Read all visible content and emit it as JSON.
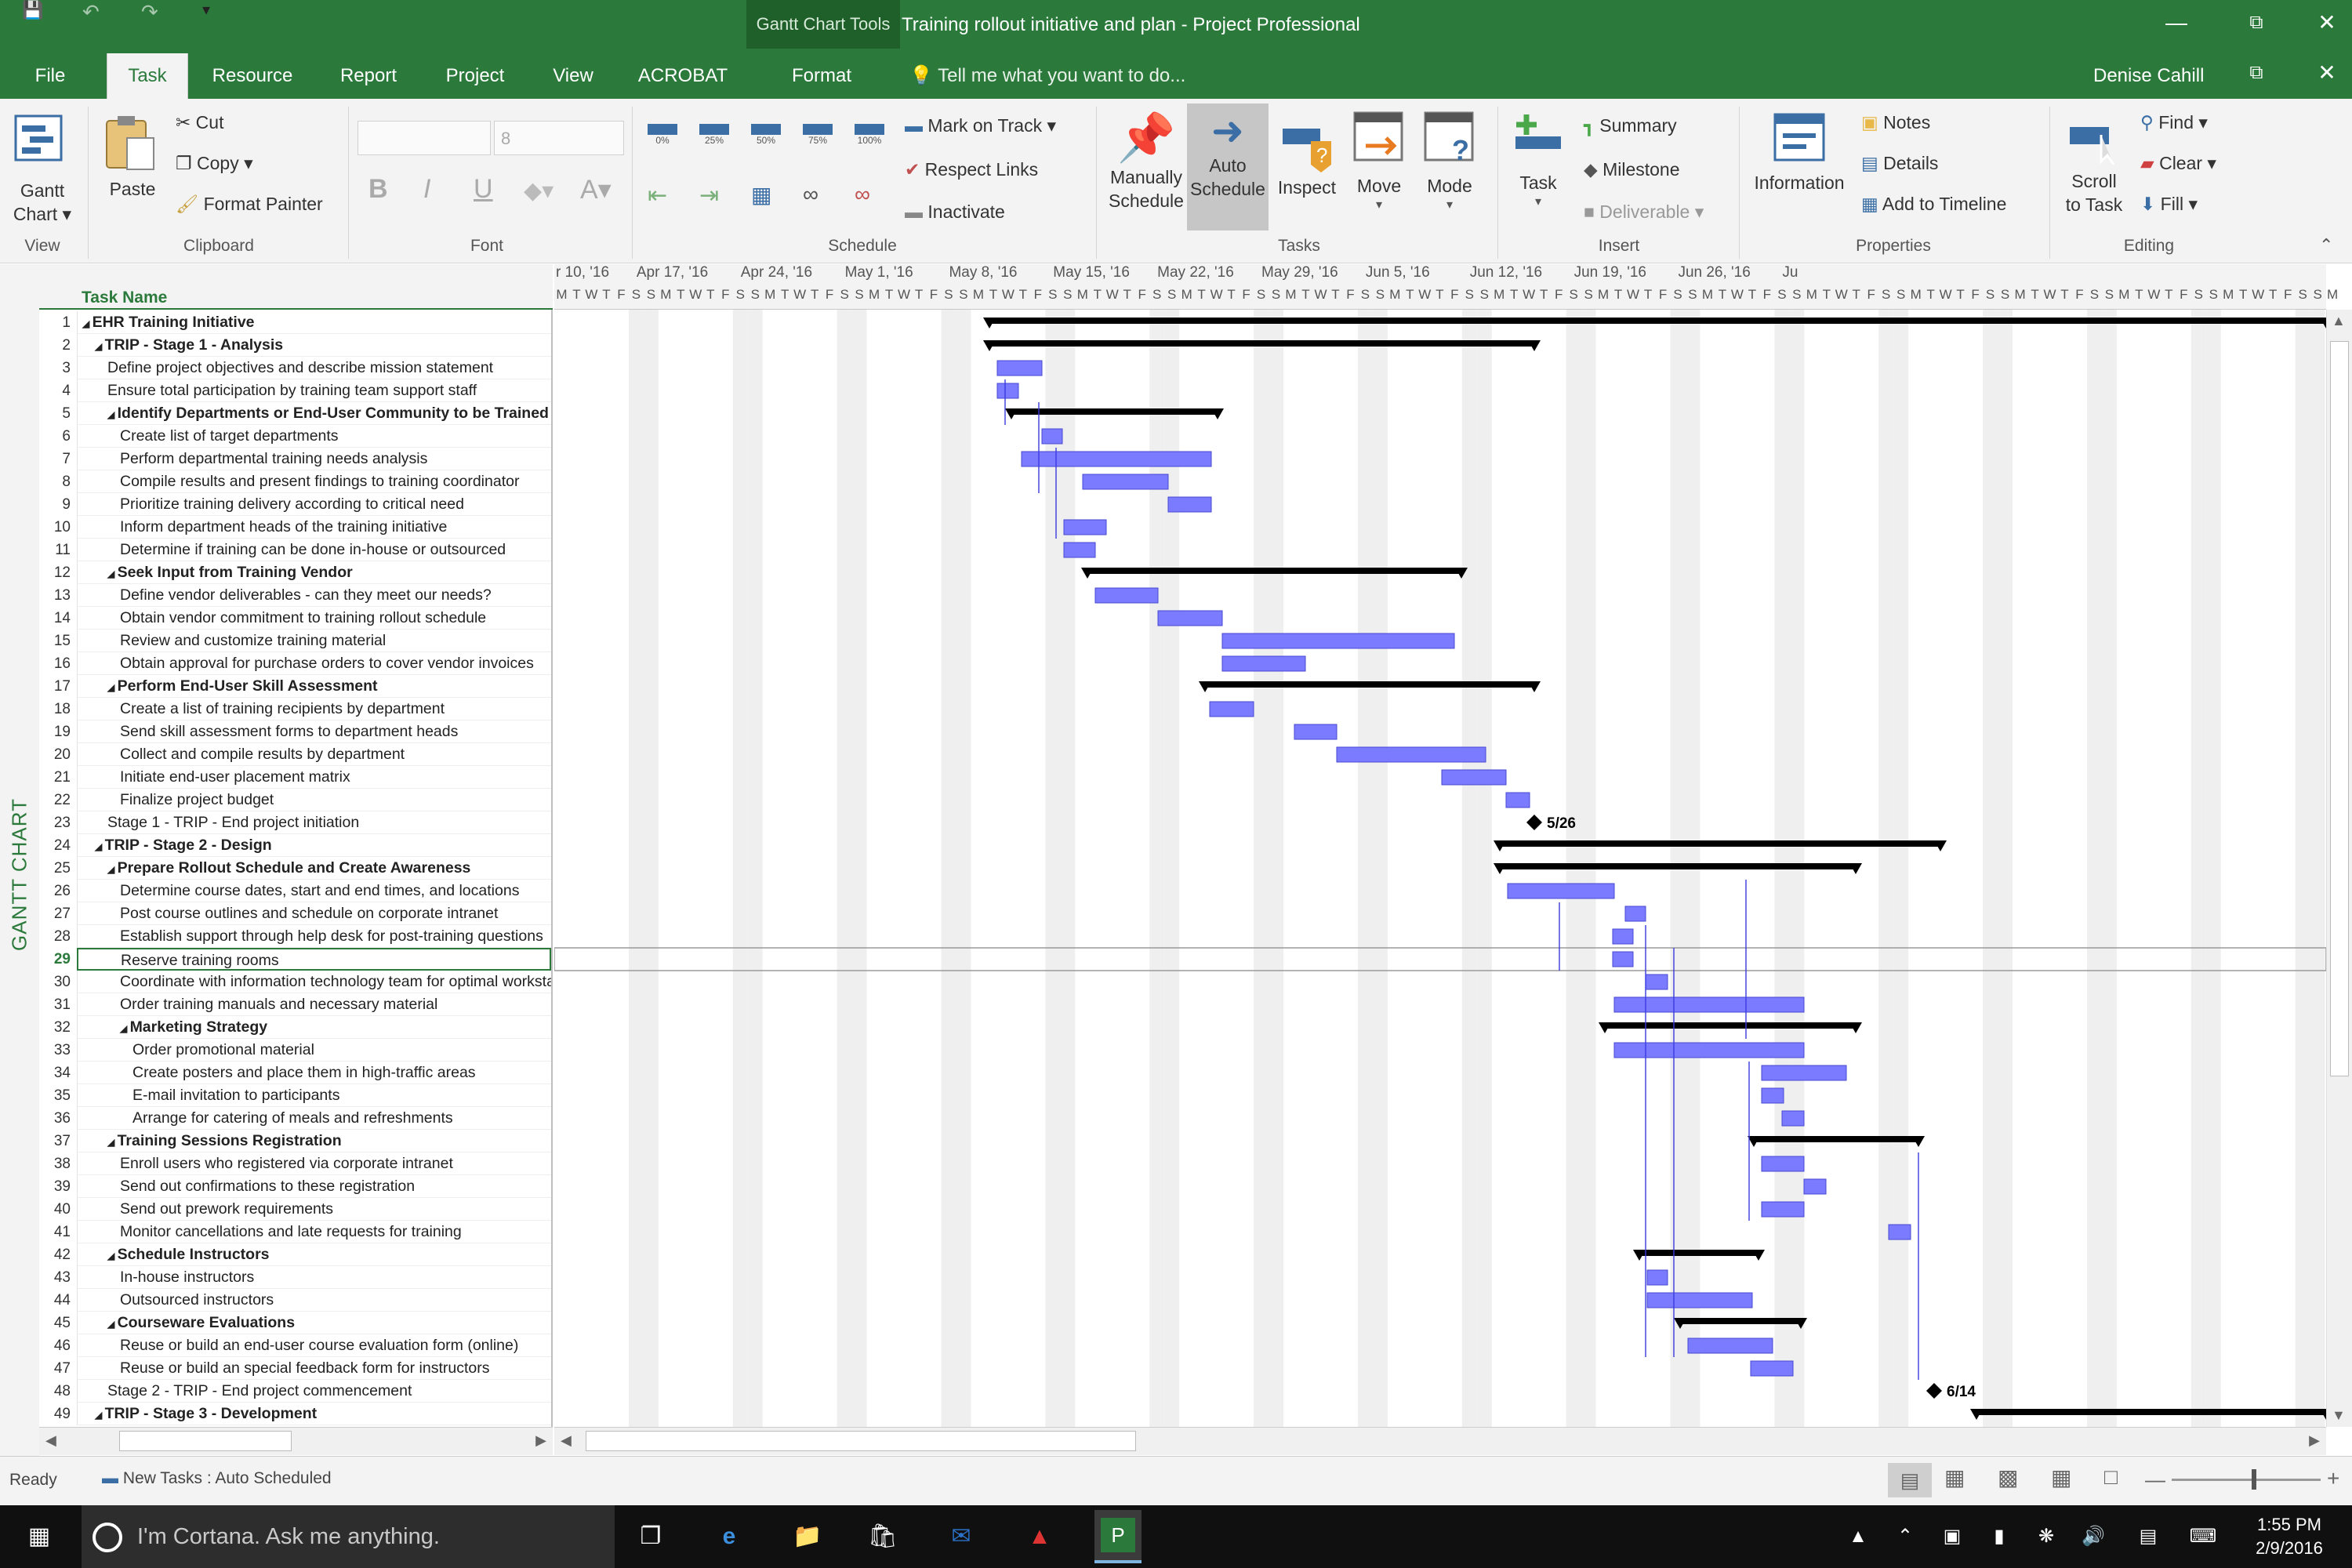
{
  "window": {
    "title": "Training rollout initiative and plan - Project Professional",
    "context_tools": "Gantt Chart Tools",
    "user": "Denise Cahill"
  },
  "tabs": [
    "File",
    "Task",
    "Resource",
    "Report",
    "Project",
    "View",
    "ACROBAT",
    "Format"
  ],
  "active_tab": "Task",
  "tellme": "Tell me what you want to do...",
  "ribbon": {
    "view": {
      "gantt_chart": "Gantt Chart",
      "group": "View",
      "gantt_l1": "Gantt",
      "gantt_l2": "Chart"
    },
    "clipboard": {
      "paste": "Paste",
      "cut": "Cut",
      "copy": "Copy",
      "format_painter": "Format Painter",
      "group": "Clipboard"
    },
    "font": {
      "size": "8",
      "group": "Font"
    },
    "schedule": {
      "pcts": [
        "0%",
        "25%",
        "50%",
        "75%",
        "100%"
      ],
      "mark_on_track": "Mark on Track",
      "respect_links": "Respect Links",
      "inactivate": "Inactivate",
      "group": "Schedule"
    },
    "tasks": {
      "manually_l1": "Manually",
      "manually_l2": "Schedule",
      "auto_l1": "Auto",
      "auto_l2": "Schedule",
      "inspect": "Inspect",
      "move": "Move",
      "mode": "Mode",
      "group": "Tasks"
    },
    "insert": {
      "task": "Task",
      "summary": "Summary",
      "milestone": "Milestone",
      "deliverable": "Deliverable",
      "group": "Insert"
    },
    "properties": {
      "information": "Information",
      "notes": "Notes",
      "details": "Details",
      "add_to_timeline": "Add to Timeline",
      "group": "Properties"
    },
    "editing": {
      "scroll_l1": "Scroll",
      "scroll_l2": "to Task",
      "find": "Find",
      "clear": "Clear",
      "fill": "Fill",
      "group": "Editing"
    }
  },
  "side_label": "GANTT CHART",
  "table": {
    "header": "Task Name"
  },
  "timescale": {
    "weeks": [
      "r 10, '16",
      "Apr 17, '16",
      "Apr 24, '16",
      "May 1, '16",
      "May 8, '16",
      "May 15, '16",
      "May 22, '16",
      "May 29, '16",
      "Jun 5, '16",
      "Jun 12, '16",
      "Jun 19, '16",
      "Jun 26, '16",
      "Ju"
    ],
    "days": [
      "M",
      "T",
      "W",
      "T",
      "F",
      "S",
      "S"
    ]
  },
  "tasks": [
    {
      "id": "1",
      "name": "EHR Training Initiative",
      "level": 0,
      "summary": true
    },
    {
      "id": "2",
      "name": "TRIP - Stage 1 - Analysis",
      "level": 1,
      "summary": true
    },
    {
      "id": "3",
      "name": "Define project objectives and describe mission statement",
      "level": 2,
      "summary": false
    },
    {
      "id": "4",
      "name": "Ensure total participation by training team support staff",
      "level": 2,
      "summary": false
    },
    {
      "id": "5",
      "name": "Identify Departments or End-User Community to be Trained",
      "level": 2,
      "summary": true
    },
    {
      "id": "6",
      "name": "Create list of target departments",
      "level": 3,
      "summary": false
    },
    {
      "id": "7",
      "name": "Perform departmental training needs analysis",
      "level": 3,
      "summary": false
    },
    {
      "id": "8",
      "name": "Compile results and present findings to training coordinator",
      "level": 3,
      "summary": false
    },
    {
      "id": "9",
      "name": "Prioritize training delivery according to critical need",
      "level": 3,
      "summary": false
    },
    {
      "id": "10",
      "name": "Inform department heads of the training initiative",
      "level": 3,
      "summary": false
    },
    {
      "id": "11",
      "name": "Determine if training can be done in-house or outsourced",
      "level": 3,
      "summary": false
    },
    {
      "id": "12",
      "name": "Seek Input from Training Vendor",
      "level": 2,
      "summary": true
    },
    {
      "id": "13",
      "name": "Define vendor deliverables - can they meet our needs?",
      "level": 3,
      "summary": false
    },
    {
      "id": "14",
      "name": "Obtain vendor commitment to training rollout schedule",
      "level": 3,
      "summary": false
    },
    {
      "id": "15",
      "name": "Review and customize training material",
      "level": 3,
      "summary": false
    },
    {
      "id": "16",
      "name": "Obtain approval for purchase orders to cover vendor invoices",
      "level": 3,
      "summary": false
    },
    {
      "id": "17",
      "name": "Perform End-User Skill Assessment",
      "level": 2,
      "summary": true
    },
    {
      "id": "18",
      "name": "Create a list of training recipients by department",
      "level": 3,
      "summary": false
    },
    {
      "id": "19",
      "name": "Send skill assessment forms to department heads",
      "level": 3,
      "summary": false
    },
    {
      "id": "20",
      "name": "Collect and compile results by department",
      "level": 3,
      "summary": false
    },
    {
      "id": "21",
      "name": "Initiate end-user placement matrix",
      "level": 3,
      "summary": false
    },
    {
      "id": "22",
      "name": "Finalize project budget",
      "level": 3,
      "summary": false
    },
    {
      "id": "23",
      "name": "Stage 1 - TRIP - End project initiation",
      "level": 2,
      "summary": false
    },
    {
      "id": "24",
      "name": "TRIP - Stage 2 - Design",
      "level": 1,
      "summary": true
    },
    {
      "id": "25",
      "name": "Prepare Rollout Schedule and Create Awareness",
      "level": 2,
      "summary": true
    },
    {
      "id": "26",
      "name": "Determine course dates, start and end times, and locations",
      "level": 3,
      "summary": false
    },
    {
      "id": "27",
      "name": "Post course outlines and schedule on corporate intranet",
      "level": 3,
      "summary": false
    },
    {
      "id": "28",
      "name": "Establish support through help desk for post-training questions",
      "level": 3,
      "summary": false
    },
    {
      "id": "29",
      "name": "Reserve training rooms",
      "level": 3,
      "summary": false
    },
    {
      "id": "30",
      "name": "Coordinate with information technology team for optimal workstations",
      "level": 3,
      "summary": false
    },
    {
      "id": "31",
      "name": "Order training manuals and necessary material",
      "level": 3,
      "summary": false
    },
    {
      "id": "32",
      "name": "Marketing Strategy",
      "level": 3,
      "summary": true
    },
    {
      "id": "33",
      "name": "Order promotional material",
      "level": 4,
      "summary": false
    },
    {
      "id": "34",
      "name": "Create posters and place them in high-traffic areas",
      "level": 4,
      "summary": false
    },
    {
      "id": "35",
      "name": "E-mail invitation to participants",
      "level": 4,
      "summary": false
    },
    {
      "id": "36",
      "name": "Arrange for catering of meals and refreshments",
      "level": 4,
      "summary": false
    },
    {
      "id": "37",
      "name": "Training Sessions Registration",
      "level": 2,
      "summary": true
    },
    {
      "id": "38",
      "name": "Enroll users who registered via corporate intranet",
      "level": 3,
      "summary": false
    },
    {
      "id": "39",
      "name": "Send out confirmations to these registration",
      "level": 3,
      "summary": false
    },
    {
      "id": "40",
      "name": "Send out prework requirements",
      "level": 3,
      "summary": false
    },
    {
      "id": "41",
      "name": "Monitor cancellations and late requests for training",
      "level": 3,
      "summary": false
    },
    {
      "id": "42",
      "name": "Schedule Instructors",
      "level": 2,
      "summary": true
    },
    {
      "id": "43",
      "name": "In-house instructors",
      "level": 3,
      "summary": false
    },
    {
      "id": "44",
      "name": "Outsourced instructors",
      "level": 3,
      "summary": false
    },
    {
      "id": "45",
      "name": "Courseware Evaluations",
      "level": 2,
      "summary": true
    },
    {
      "id": "46",
      "name": "Reuse or build an end-user course evaluation form (online)",
      "level": 3,
      "summary": false
    },
    {
      "id": "47",
      "name": "Reuse or build an special feedback form for instructors",
      "level": 3,
      "summary": false
    },
    {
      "id": "48",
      "name": "Stage 2 - TRIP - End project commencement",
      "level": 2,
      "summary": false
    },
    {
      "id": "49",
      "name": "TRIP - Stage 3 - Development",
      "level": 1,
      "summary": true
    }
  ],
  "selected_row": "29",
  "milestones": [
    {
      "row": "23",
      "label": "5/26"
    },
    {
      "row": "48",
      "label": "6/14"
    }
  ],
  "status": {
    "ready": "Ready",
    "new_tasks": "New Tasks : Auto Scheduled"
  },
  "taskbar": {
    "cortana": "I'm Cortana. Ask me anything.",
    "time": "1:55 PM",
    "date": "2/9/2016"
  },
  "colors": {
    "green": "#2b7a3b",
    "task_bar": "#7b7bff",
    "summary_bar": "#000000"
  }
}
